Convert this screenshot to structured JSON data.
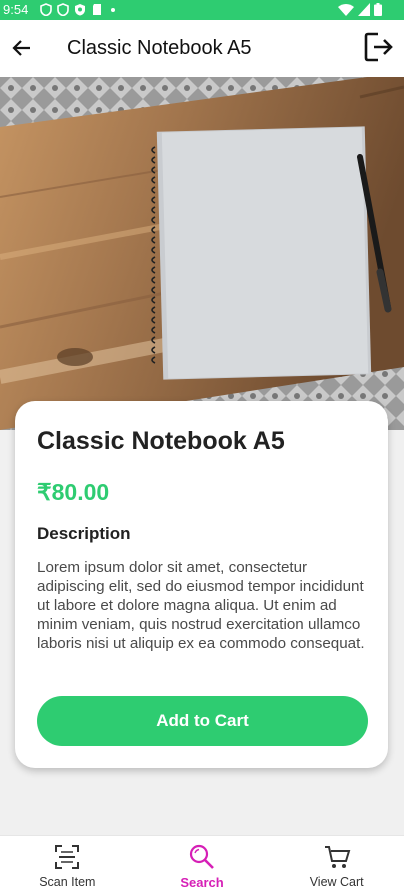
{
  "status_bar": {
    "time": "9:54",
    "icons": [
      "shield-icon",
      "shield-icon",
      "shield-icon",
      "sd-card-icon",
      "dot-icon",
      "wifi-icon",
      "signal-icon",
      "battery-icon"
    ]
  },
  "app_bar": {
    "title": "Classic Notebook A5",
    "back_icon": "arrow-left-icon",
    "logout_icon": "logout-icon"
  },
  "product": {
    "name": "Classic Notebook A5",
    "price": "₹80.00",
    "description_label": "Description",
    "description": "Lorem ipsum dolor sit amet, consectetur adipiscing elit, sed do eiusmod tempor incididunt ut labore et dolore magna aliqua. Ut enim ad minim veniam, quis nostrud exercitation ullamco laboris nisi ut aliquip ex ea commodo consequat.",
    "add_to_cart_label": "Add to Cart"
  },
  "bottom_nav": {
    "items": [
      {
        "label": "Scan Item",
        "icon": "scan-icon",
        "active": false
      },
      {
        "label": "Search",
        "icon": "search-icon",
        "active": true
      },
      {
        "label": "View Cart",
        "icon": "cart-icon",
        "active": false
      }
    ]
  },
  "colors": {
    "accent": "#2ecc71",
    "active_nav": "#d61fb6"
  }
}
